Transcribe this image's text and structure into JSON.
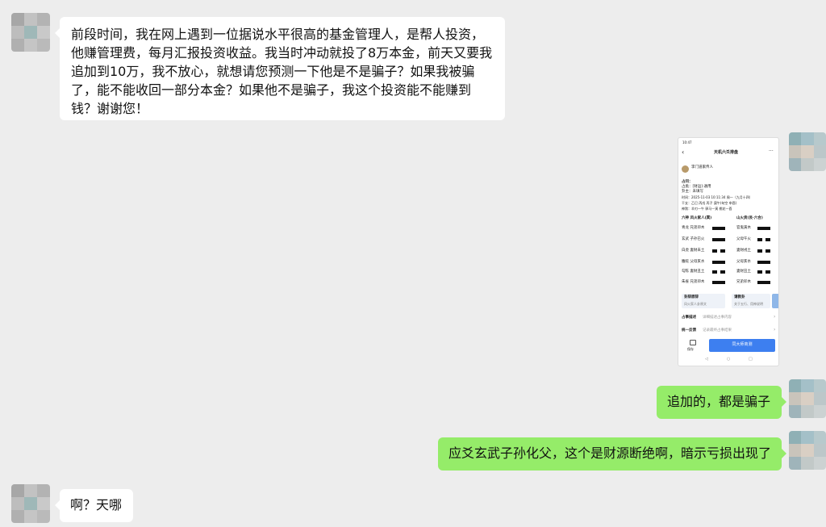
{
  "messages": [
    {
      "side": "left",
      "text": "前段时间，我在网上遇到一位据说水平很高的基金管理人，是帮人投资，他赚管理费，每月汇报投资收益。我当时冲动就投了8万本金，前天又要我追加到10万，我不放心，就想请您预测一下他是不是骗子？如果我被骗了，能不能收回一部分本金？如果他不是骗子，我这个投资能不能赚到钱？谢谢您！"
    },
    {
      "side": "right",
      "type": "image"
    },
    {
      "side": "right",
      "text": "追加的，都是骗子"
    },
    {
      "side": "right",
      "text": "应爻玄武子孙化父，这个是财源断绝啊，暗示亏损出现了"
    },
    {
      "side": "left",
      "text": "啊？天哪"
    }
  ],
  "screenshot": {
    "status_time": "10:47",
    "title": "天机六爻排盘",
    "user_name": "李门道家传人",
    "section_label": "占问：",
    "row_divination": "占类：[财运]·通用",
    "row_subject": "卦主：未填写",
    "row_time": "时间：2025-11-03 10:11:34 周一（九月十四）",
    "row_ganzhi": "干支：乙巳 丙戌 丙子 庚午(旬空 申酉)",
    "row_shen": "神煞：羊刃—午  驿马—寅  桃花—酉",
    "col_left": "六神  风火家人(巽)",
    "col_right": "山火贲(艮·六合)",
    "lines_left": [
      "青龙 兄弟卯木",
      "玄武 子孙巳火",
      "白虎 妻财未土",
      "螣蛇 父母亥水",
      "勾陈 妻财丑土",
      "朱雀 兄弟卯木"
    ],
    "lines_right": [
      "官鬼寅木",
      "父母午火",
      "妻财戌土",
      "父母亥水",
      "妻财丑土",
      "兄弟卯木"
    ],
    "card_left_title": "卦辞原辞",
    "card_left_sub": "风火家人卦原文",
    "card_right_title": "请教卦",
    "card_right_sub": "关于五行、用神说明",
    "row_desc_label": "占事描述",
    "row_desc_value": "详细描述占事内容",
    "row_review_label": "统一反馈",
    "row_review_value": "记录最终占事结果",
    "save_label": "保存",
    "bottom_button": "同大师商测"
  },
  "colors": {
    "background": "#ededed",
    "bubble_left": "#ffffff",
    "bubble_right": "#95ec69",
    "accent_blue": "#3d7ff0"
  }
}
